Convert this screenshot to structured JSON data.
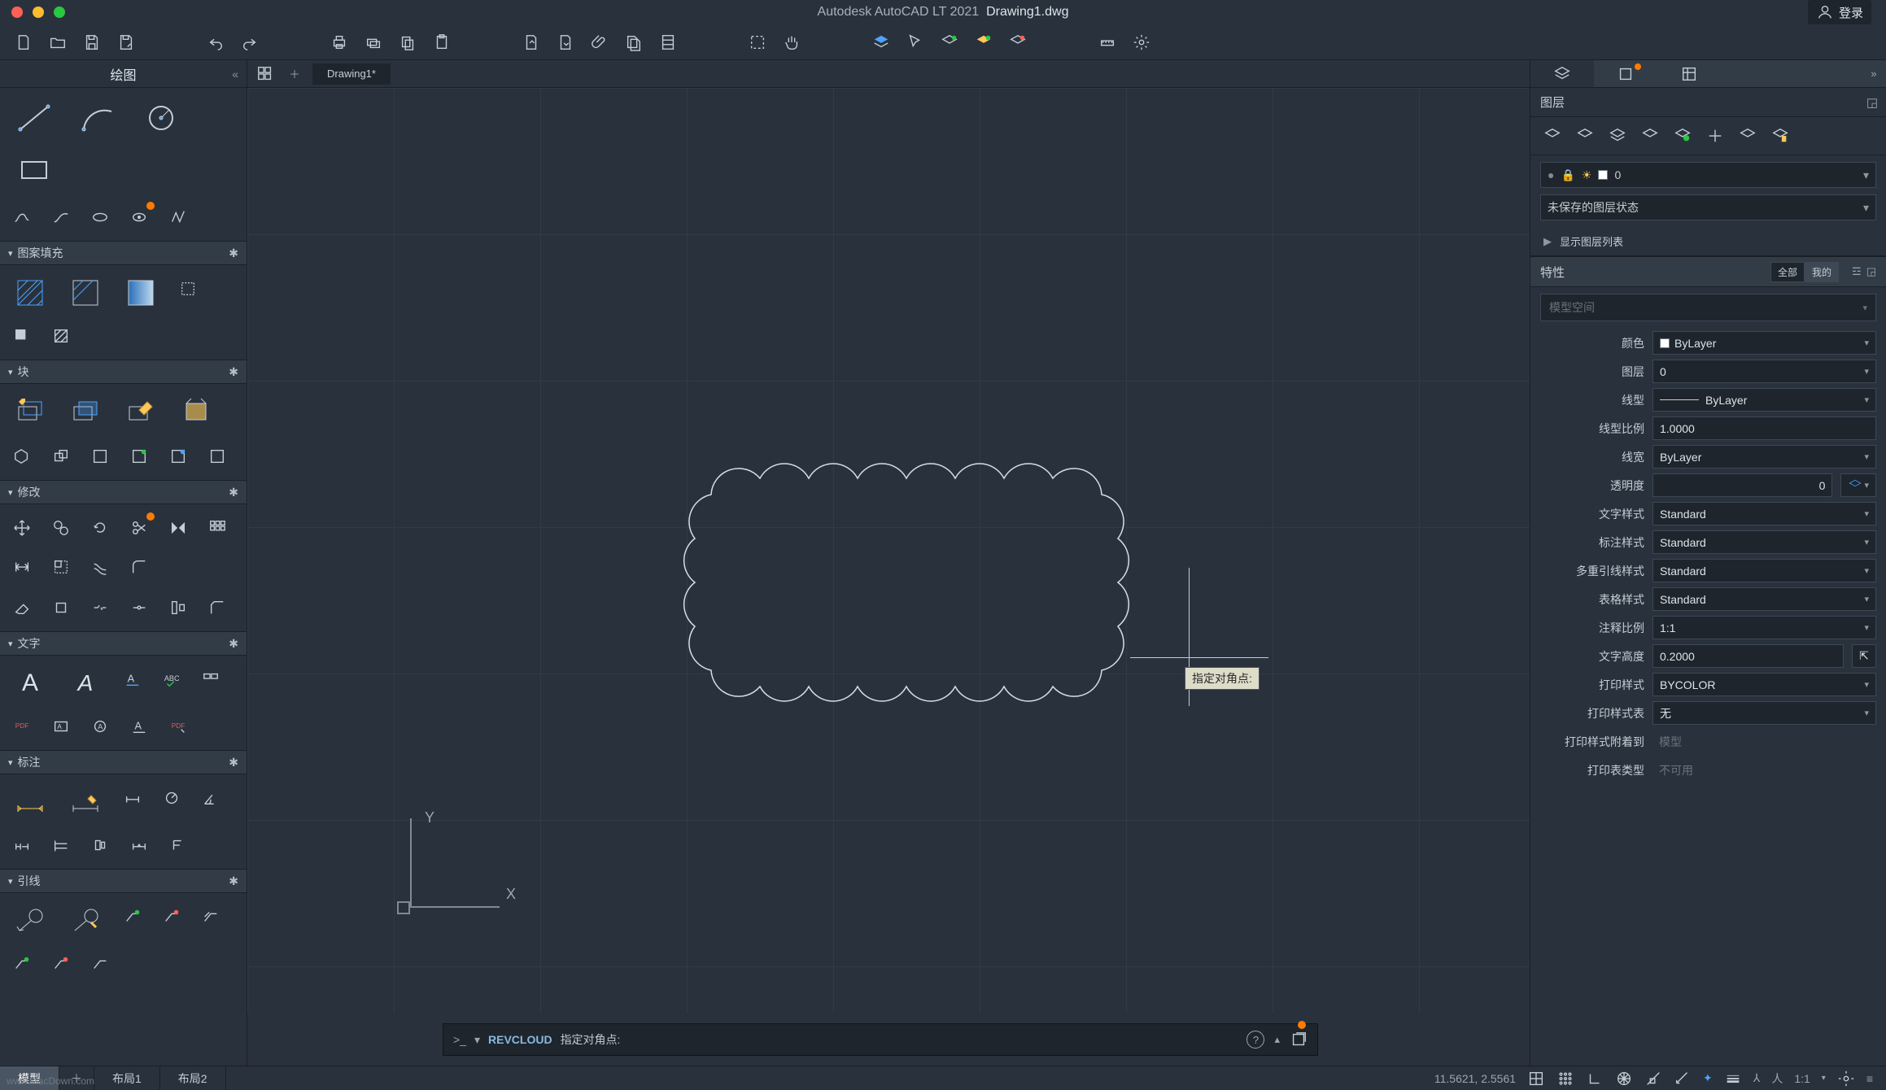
{
  "app": {
    "product": "Autodesk AutoCAD LT 2021",
    "filename": "Drawing1.dwg",
    "login": "登录"
  },
  "sidebar_left": {
    "title": "绘图",
    "panels": {
      "hatch": "图案填充",
      "block": "块",
      "modify": "修改",
      "text": "文字",
      "dim": "标注",
      "leader": "引线"
    }
  },
  "tabs": {
    "file": "Drawing1*"
  },
  "command": {
    "cmd": "REVCLOUD",
    "prompt": "指定对角点:",
    "tooltip": "指定对角点:"
  },
  "ucs": {
    "x": "X",
    "y": "Y"
  },
  "right": {
    "layers_title": "图层",
    "layer_current": "0",
    "layer_state": "未保存的图层状态",
    "layer_expand": "显示图层列表",
    "props_title": "特性",
    "seg_all": "全部",
    "seg_mine": "我的",
    "obj_type": "模型空间",
    "props": {
      "color_k": "颜色",
      "color_v": "ByLayer",
      "layer_k": "图层",
      "layer_v": "0",
      "ltype_k": "线型",
      "ltype_v": "ByLayer",
      "ltscale_k": "线型比例",
      "ltscale_v": "1.0000",
      "lw_k": "线宽",
      "lw_v": "ByLayer",
      "transp_k": "透明度",
      "transp_v": "0",
      "tstyle_k": "文字样式",
      "tstyle_v": "Standard",
      "dstyle_k": "标注样式",
      "dstyle_v": "Standard",
      "mlstyle_k": "多重引线样式",
      "mlstyle_v": "Standard",
      "tblstyle_k": "表格样式",
      "tblstyle_v": "Standard",
      "ascale_k": "注释比例",
      "ascale_v": "1:1",
      "theight_k": "文字高度",
      "theight_v": "0.2000",
      "pstyle_k": "打印样式",
      "pstyle_v": "BYCOLOR",
      "pstable_k": "打印样式表",
      "pstable_v": "无",
      "psattach_k": "打印样式附着到",
      "psattach_v": "模型",
      "pttype_k": "打印表类型",
      "pttype_v": "不可用"
    }
  },
  "status": {
    "model": "模型",
    "layout1": "布局1",
    "layout2": "布局2",
    "coords": "11.5621, 2.5561",
    "scale": "1:1"
  },
  "watermark": "www.MacDown.com"
}
